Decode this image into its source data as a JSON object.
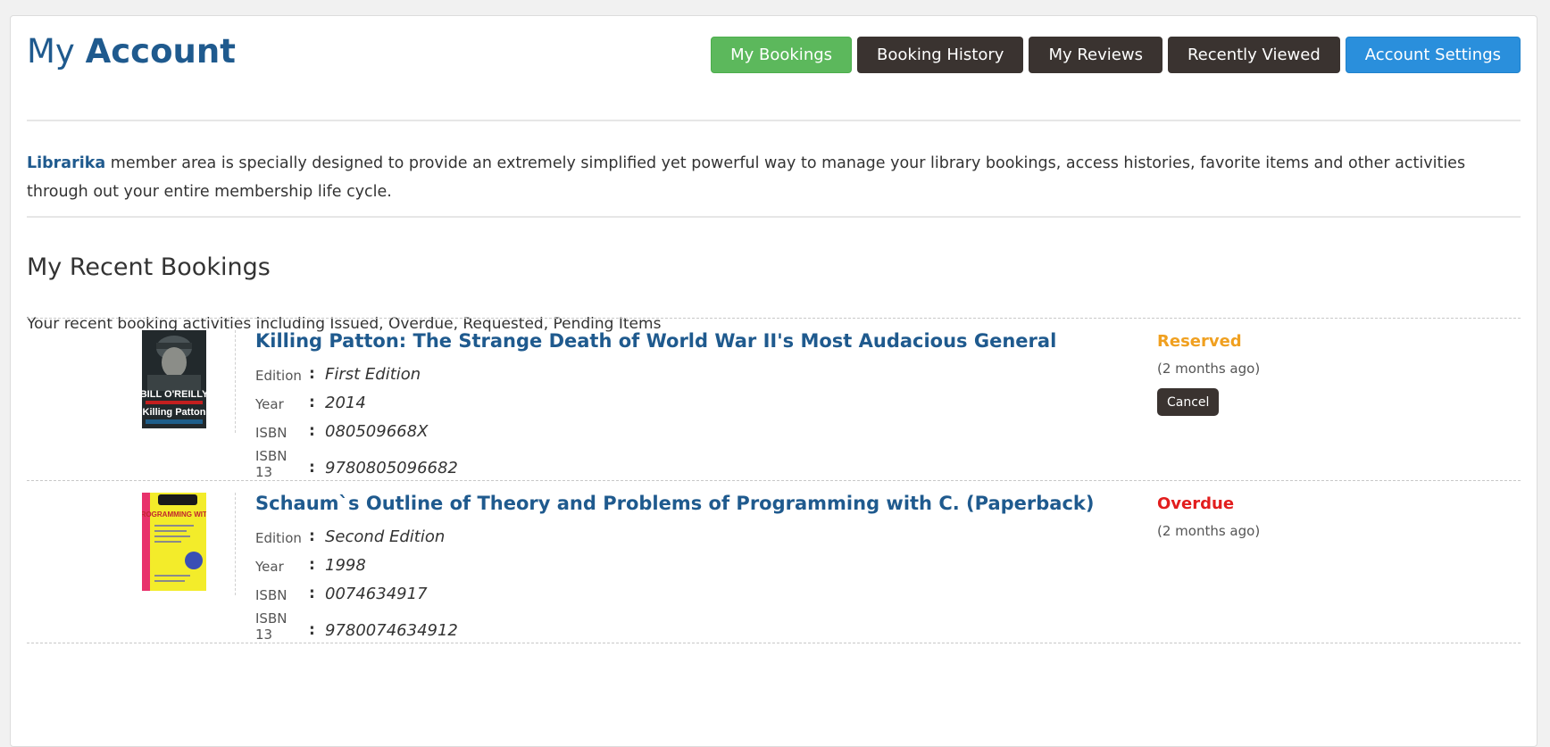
{
  "header": {
    "title_light": "My",
    "title_bold": "Account"
  },
  "nav": [
    {
      "label": "My Bookings",
      "variant": "green"
    },
    {
      "label": "Booking History",
      "variant": "dark"
    },
    {
      "label": "My Reviews",
      "variant": "dark"
    },
    {
      "label": "Recently Viewed",
      "variant": "dark"
    },
    {
      "label": "Account Settings",
      "variant": "blue"
    }
  ],
  "intro": {
    "brand": "Librarika",
    "text": " member area is specially designed to provide an extremely simplified yet powerful way to manage your library bookings, access histories, favorite items and other activities through out your entire membership life cycle."
  },
  "section": {
    "title": "My Recent Bookings",
    "subtitle": "Your recent booking activities including Issued, Overdue, Requested, Pending Items"
  },
  "meta_labels": {
    "edition": "Edition",
    "year": "Year",
    "isbn": "ISBN",
    "isbn13": "ISBN 13",
    "colon": ":"
  },
  "bookings": [
    {
      "title": "Killing Patton: The Strange Death of World War II's Most Audacious General",
      "edition": "First Edition",
      "year": "2014",
      "isbn": "080509668X",
      "isbn13": "9780805096682",
      "status": "Reserved",
      "status_color": "#f0a020",
      "ago": "(2 months ago)",
      "action": "Cancel",
      "cover": {
        "author": "BILL O'REILLY",
        "title": "Killing Patton"
      }
    },
    {
      "title": "Schaum`s Outline of Theory and Problems of Programming with C. (Paperback)",
      "edition": "Second Edition",
      "year": "1998",
      "isbn": "0074634917",
      "isbn13": "9780074634912",
      "status": "Overdue",
      "status_color": "#e21e1e",
      "ago": "(2 months ago)",
      "cover": {
        "title": "PROGRAMMING WITH C"
      }
    }
  ],
  "colors": {
    "primary": "#1f5a8e",
    "green_button": "#5cb85c",
    "dark_button": "#3a3330",
    "blue_button": "#2a8fdc"
  }
}
